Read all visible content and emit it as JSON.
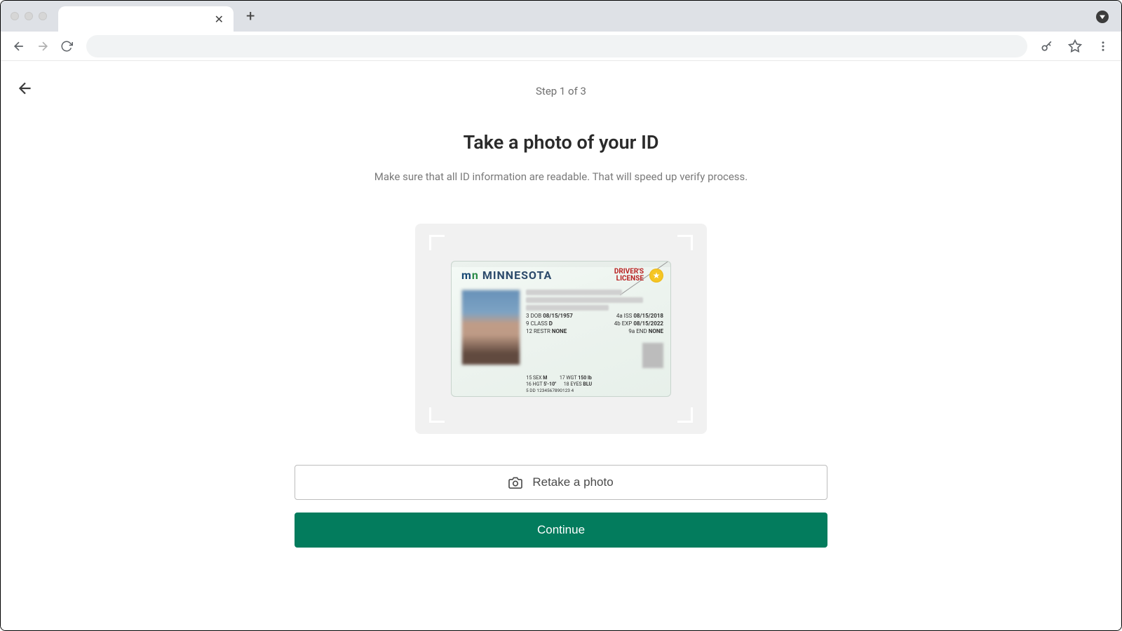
{
  "page": {
    "step_indicator": "Step 1 of 3",
    "title": "Take a photo of your ID",
    "subtitle": "Make sure that all ID information are readable. That will speed up verify process."
  },
  "buttons": {
    "retake": "Retake a photo",
    "continue": "Continue"
  },
  "id_card": {
    "state": "MINNESOTA",
    "label_line1": "DRIVER'S",
    "label_line2": "LICENSE",
    "dob_label": "3 DOB",
    "dob": "08/15/1957",
    "iss_label": "4a ISS",
    "iss": "08/15/2018",
    "exp_label": "4b EXP",
    "exp": "08/15/2022",
    "class_label": "9 CLASS",
    "class": "D",
    "end_label": "9a END",
    "end": "NONE",
    "restr_label": "12 RESTR",
    "restr": "NONE",
    "sex_label": "15 SEX",
    "sex": "M",
    "wgt_label": "17 WGT",
    "wgt": "150 lb",
    "hgt_label": "16 HGT",
    "hgt": "5'-10\"",
    "eyes_label": "18 EYES",
    "eyes": "BLU",
    "dln_label": "5 DD",
    "dln": "1234567890123 4"
  }
}
